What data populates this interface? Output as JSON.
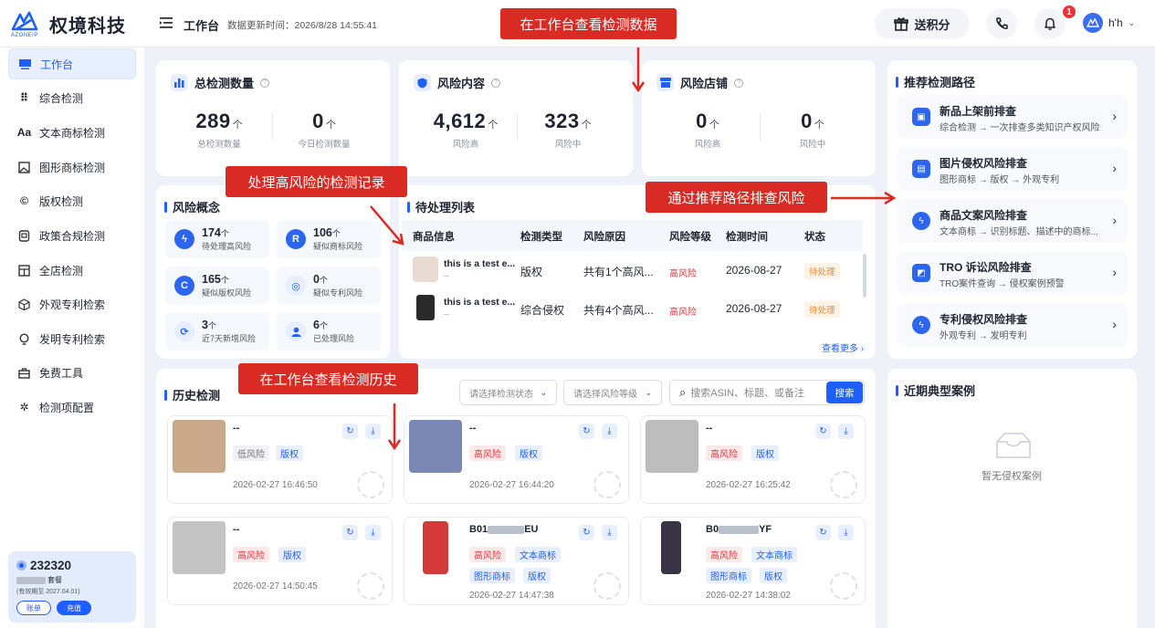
{
  "header": {
    "brand": "权境科技",
    "brand_sub": "AZONEIP",
    "crumb": "工作台",
    "update_time": "数据更新时间：2026/8/28 14:55:41",
    "gift_label": "送积分",
    "bell_count": "1",
    "user_name": "h'h"
  },
  "sidebar": {
    "items": [
      {
        "label": "工作台",
        "icon": "workbench-icon"
      },
      {
        "label": "综合检测",
        "icon": "grid-icon"
      },
      {
        "label": "文本商标检测",
        "icon": "text-icon"
      },
      {
        "label": "图形商标检测",
        "icon": "image-icon"
      },
      {
        "label": "版权检测",
        "icon": "copyright-icon"
      },
      {
        "label": "政策合规检测",
        "icon": "policy-icon"
      },
      {
        "label": "全店检测",
        "icon": "store-icon"
      },
      {
        "label": "外观专利检索",
        "icon": "cube-icon"
      },
      {
        "label": "发明专利检索",
        "icon": "bulb-icon"
      },
      {
        "label": "免费工具",
        "icon": "toolbox-icon"
      },
      {
        "label": "检测项配置",
        "icon": "config-icon"
      }
    ]
  },
  "account": {
    "id": "232320",
    "plan": "套餐",
    "expiry": "(有效期至 2027.04.01)",
    "bill_label": "账单",
    "recharge_label": "充值"
  },
  "stats": {
    "total": {
      "title": "总检测数量",
      "a_num": "289",
      "a_unit": "个",
      "a_label": "总检测数量",
      "b_num": "0",
      "b_unit": "个",
      "b_label": "今日检测数量"
    },
    "content": {
      "title": "风险内容",
      "a_num": "4,612",
      "a_unit": "个",
      "a_label": "风险高",
      "b_num": "323",
      "b_unit": "个",
      "b_label": "风险中"
    },
    "store": {
      "title": "风险店铺",
      "a_num": "0",
      "a_unit": "个",
      "a_label": "风险高",
      "b_num": "0",
      "b_unit": "个",
      "b_label": "风险中"
    }
  },
  "risk_concept": {
    "title": "风险概念",
    "items": [
      {
        "num": "174",
        "unit": "个",
        "label": "待处理高风险",
        "icon": "bolt-icon"
      },
      {
        "num": "106",
        "unit": "个",
        "label": "疑似商标风险",
        "icon": "registered-icon"
      },
      {
        "num": "165",
        "unit": "个",
        "label": "疑似版权风险",
        "icon": "copyright-icon"
      },
      {
        "num": "0",
        "unit": "个",
        "label": "疑似专利风险",
        "icon": "badge-icon"
      },
      {
        "num": "3",
        "unit": "个",
        "label": "近7天新增风险",
        "icon": "refresh-icon"
      },
      {
        "num": "6",
        "unit": "个",
        "label": "已处理风险",
        "icon": "user-icon"
      }
    ]
  },
  "pending": {
    "title": "待处理列表",
    "columns": [
      "商品信息",
      "检测类型",
      "风险原因",
      "风险等级",
      "检测时间",
      "状态"
    ],
    "rows": [
      {
        "name": "this is a test e...",
        "sub": "--",
        "type": "版权",
        "reason": "共有1个高风...",
        "level": "高风险",
        "time": "2026-08-27",
        "status": "待处理"
      },
      {
        "name": "this is a test e...",
        "sub": "--",
        "type": "综合侵权",
        "reason": "共有4个高风...",
        "level": "高风险",
        "time": "2026-08-27",
        "status": "待处理"
      }
    ],
    "more": "查看更多 ›"
  },
  "history": {
    "title": "历史检测",
    "status_placeholder": "请选择检测状态",
    "level_placeholder": "请选择风险等级",
    "search_placeholder": "搜索ASIN、标题、或备注",
    "search_btn": "搜索",
    "cards": [
      {
        "title": "--",
        "tags": [
          "低风险",
          "版权"
        ],
        "time": "2026-02-27 16:46:50"
      },
      {
        "title": "--",
        "tags": [
          "高风险",
          "版权"
        ],
        "time": "2026-02-27 16:44:20"
      },
      {
        "title": "--",
        "tags": [
          "高风险",
          "版权"
        ],
        "time": "2026-02-27 16:25:42"
      },
      {
        "title": "--",
        "tags": [
          "高风险",
          "版权"
        ],
        "time": "2026-02-27 14:50:45"
      },
      {
        "title_a": "B01",
        "title_b": "EU",
        "tags": [
          "高风险",
          "文本商标",
          "图形商标",
          "版权"
        ],
        "time": "2026-02-27 14:47:38"
      },
      {
        "title_a": "B0",
        "title_b": "YF",
        "tags": [
          "高风险",
          "文本商标",
          "图形商标",
          "版权"
        ],
        "time": "2026-02-27 14:38:02"
      }
    ]
  },
  "paths": {
    "title": "推荐检测路径",
    "items": [
      {
        "title": "新品上架前排查",
        "sub": "综合检测 → 一次排查多类知识产权风险"
      },
      {
        "title": "图片侵权风险排查",
        "sub": "图形商标 → 版权 → 外观专利"
      },
      {
        "title": "商品文案风险排查",
        "sub": "文本商标 → 识别标题、描述中的商标..."
      },
      {
        "title": "TRO 诉讼风险排查",
        "sub": "TRO案件查询 → 侵权案例预警"
      },
      {
        "title": "专利侵权风险排查",
        "sub": "外观专利 → 发明专利"
      }
    ]
  },
  "cases": {
    "title": "近期典型案例",
    "empty": "暂无侵权案例"
  },
  "annotations": {
    "top": "在工作台查看检测数据",
    "high_risk": "处理高风险的检测记录",
    "path": "通过推荐路径排查风险",
    "history": "在工作台查看检测历史"
  },
  "colors": {
    "accent": "#1f5eff",
    "danger": "#e8333b",
    "annotation": "#d92a23",
    "pending": "#f08a24"
  }
}
